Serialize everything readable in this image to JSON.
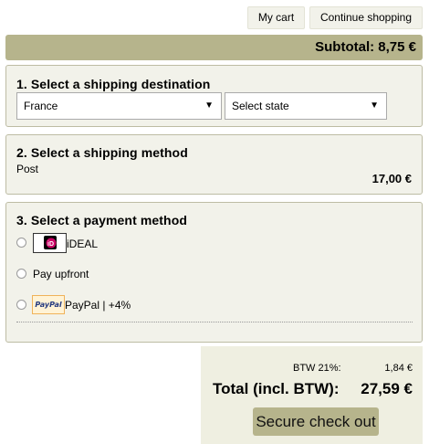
{
  "header": {
    "my_cart": "My cart",
    "continue_shopping": "Continue shopping"
  },
  "subtotal": "Subtotal: 8,75 €",
  "destination": {
    "title": "1. Select a shipping destination",
    "country": "France",
    "state": "Select state"
  },
  "shipping": {
    "title": "2. Select a shipping method",
    "method": "Post",
    "price": "17,00 €"
  },
  "payment": {
    "title": "3. Select a payment method",
    "options": [
      {
        "label": "iDEAL",
        "icon": "ideal-logo"
      },
      {
        "label": "Pay upfront"
      },
      {
        "label": "PayPal | +4%",
        "icon": "paypal-logo",
        "logo_text": "PayPal"
      }
    ],
    "ideal_logo_text": "iD"
  },
  "summary": {
    "vat_label": "BTW 21%:",
    "vat_value": "1,84 €",
    "total_label": "Total (incl. BTW):",
    "total_value": "27,59 €",
    "checkout_label": "Secure check out"
  },
  "colors": {
    "accent": "#b6b48c",
    "panel": "#f2f2ea",
    "summary_bg": "#efefe1"
  }
}
